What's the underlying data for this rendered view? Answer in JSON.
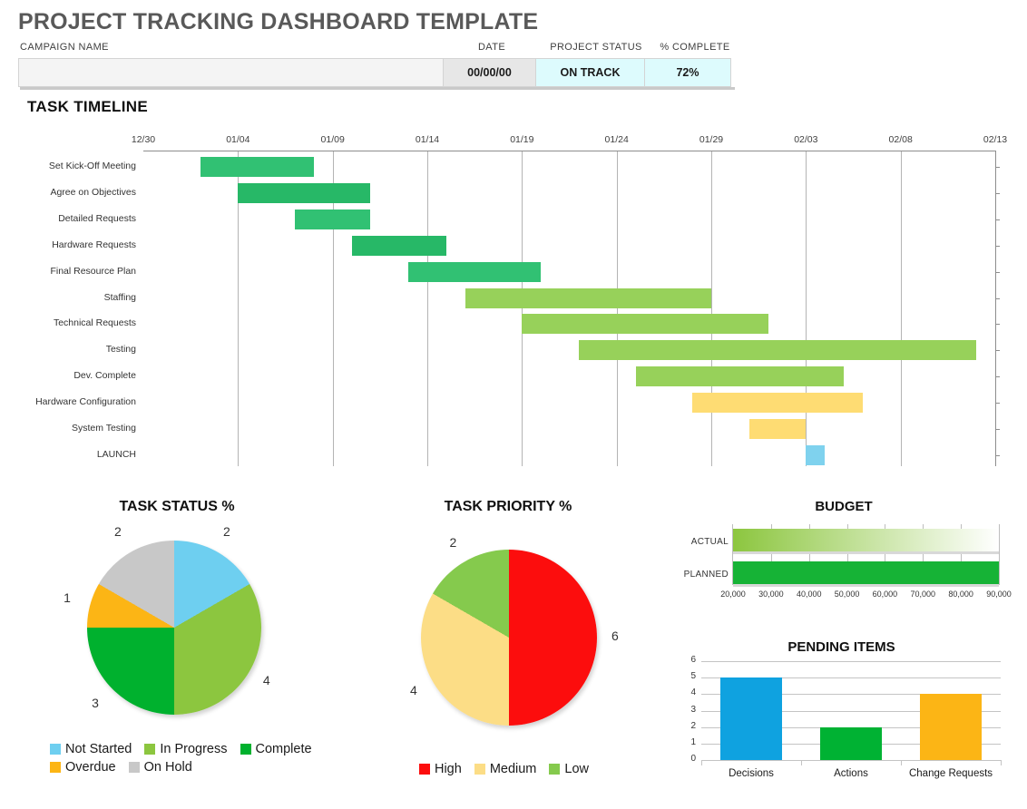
{
  "header": {
    "title": "PROJECT TRACKING DASHBOARD TEMPLATE",
    "campaign_label": "CAMPAIGN NAME",
    "campaign_value": "",
    "date_label": "DATE",
    "date_value": "00/00/00",
    "status_label": "PROJECT STATUS",
    "status_value": "ON TRACK",
    "percent_label": "% COMPLETE",
    "percent_value": "72%",
    "status_bg": "#ddfbfd",
    "date_bg": "#e7e7e7"
  },
  "sections": {
    "timeline": "TASK TIMELINE",
    "task_status": "TASK STATUS %",
    "task_priority": "TASK PRIORITY %",
    "budget": "BUDGET",
    "pending": "PENDING ITEMS"
  },
  "chart_data": [
    {
      "type": "bar",
      "name": "task-timeline-gantt",
      "title": "TASK TIMELINE",
      "orientation": "horizontal",
      "xlabel": "",
      "ylabel": "",
      "axis_ticks": [
        "12/30",
        "01/04",
        "01/09",
        "01/14",
        "01/19",
        "01/24",
        "01/29",
        "02/03",
        "02/08",
        "02/13"
      ],
      "tick_interval_days": 5,
      "xlim": [
        "12/30",
        "02/13"
      ],
      "grid": true,
      "categories": [
        "Set Kick-Off Meeting",
        "Agree on Objectives",
        "Detailed Requests",
        "Hardware Requests",
        "Final Resource Plan",
        "Staffing",
        "Technical Requests",
        "Testing",
        "Dev. Complete",
        "Hardware Configuration",
        "System Testing",
        "LAUNCH"
      ],
      "bars": [
        {
          "task": "Set Kick-Off Meeting",
          "start_day": 3,
          "end_day": 9,
          "color": "#31c173"
        },
        {
          "task": "Agree on Objectives",
          "start_day": 5,
          "end_day": 12,
          "color": "#27b867"
        },
        {
          "task": "Detailed Requests",
          "start_day": 8,
          "end_day": 12,
          "color": "#31c173"
        },
        {
          "task": "Hardware Requests",
          "start_day": 11,
          "end_day": 16,
          "color": "#27b867"
        },
        {
          "task": "Final Resource Plan",
          "start_day": 14,
          "end_day": 21,
          "color": "#31c173"
        },
        {
          "task": "Staffing",
          "start_day": 17,
          "end_day": 30,
          "color": "#97d15a"
        },
        {
          "task": "Technical Requests",
          "start_day": 20,
          "end_day": 33,
          "color": "#97d15a"
        },
        {
          "task": "Testing",
          "start_day": 23,
          "end_day": 44,
          "color": "#97d15a"
        },
        {
          "task": "Dev. Complete",
          "start_day": 26,
          "end_day": 37,
          "color": "#97d15a"
        },
        {
          "task": "Hardware Configuration",
          "start_day": 29,
          "end_day": 38,
          "color": "#fedc73"
        },
        {
          "task": "System Testing",
          "start_day": 32,
          "end_day": 35,
          "color": "#fedc73"
        },
        {
          "task": "LAUNCH",
          "start_day": 35,
          "end_day": 36,
          "color": "#7fd2ee"
        }
      ]
    },
    {
      "type": "pie",
      "name": "task-status-pie",
      "title": "TASK STATUS %",
      "legend_position": "bottom",
      "labels": [
        "Not Started",
        "In Progress",
        "Complete",
        "Overdue",
        "On Hold"
      ],
      "values": [
        2,
        4,
        3,
        1,
        2
      ],
      "colors": [
        "#6ecff0",
        "#8cc63f",
        "#00b12e",
        "#fcb515",
        "#c8c8c8"
      ],
      "total": 12
    },
    {
      "type": "pie",
      "name": "task-priority-pie",
      "title": "TASK PRIORITY %",
      "legend_position": "bottom",
      "labels": [
        "High",
        "Medium",
        "Low"
      ],
      "values": [
        6,
        4,
        2
      ],
      "colors": [
        "#fc0d0d",
        "#fcdd86",
        "#85ca4d"
      ],
      "total": 12
    },
    {
      "type": "bar",
      "name": "budget-bar",
      "title": "BUDGET",
      "orientation": "horizontal",
      "categories": [
        "ACTUAL",
        "PLANNED"
      ],
      "values": [
        90000,
        90000
      ],
      "colors": [
        "#93ce5b",
        "#16b336"
      ],
      "xlim": [
        20000,
        90000
      ],
      "axis_ticks": [
        "20,000",
        "30,000",
        "40,000",
        "50,000",
        "60,000",
        "70,000",
        "80,000",
        "90,000"
      ],
      "grid": true
    },
    {
      "type": "bar",
      "name": "pending-items-bar",
      "title": "PENDING ITEMS",
      "orientation": "vertical",
      "categories": [
        "Decisions",
        "Actions",
        "Change Requests"
      ],
      "values": [
        5,
        2,
        4
      ],
      "colors": [
        "#0fa2e0",
        "#00b233",
        "#fcb515"
      ],
      "ylim": [
        0,
        6
      ],
      "y_ticks": [
        "0",
        "1",
        "2",
        "3",
        "4",
        "5",
        "6"
      ],
      "grid": true
    }
  ]
}
